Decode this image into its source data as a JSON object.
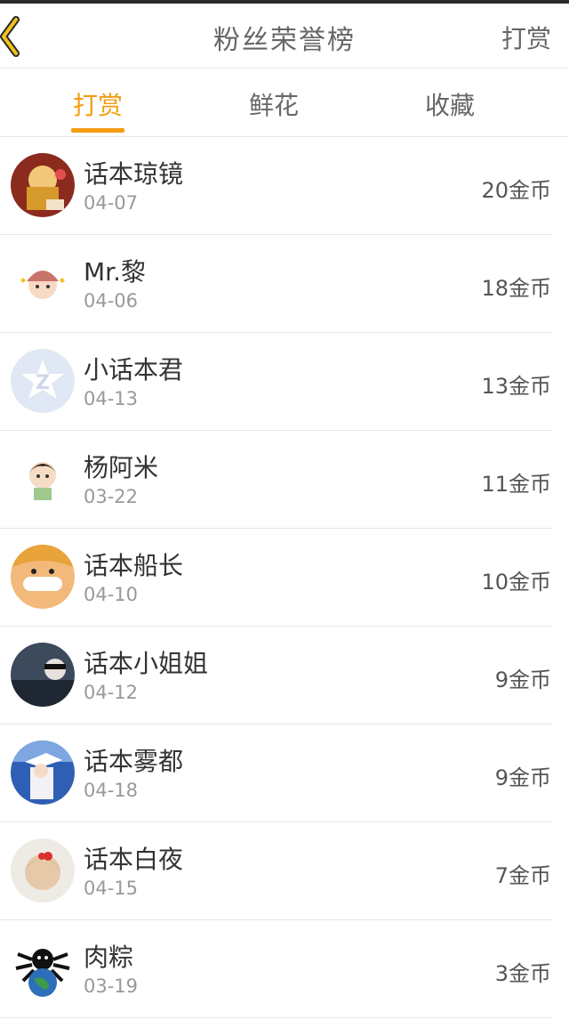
{
  "header": {
    "title": "粉丝荣誉榜",
    "action_label": "打赏",
    "accent": "#f39c12"
  },
  "tabs": [
    {
      "label": "打赏",
      "active": true
    },
    {
      "label": "鲜花",
      "active": false
    },
    {
      "label": "收藏",
      "active": false
    }
  ],
  "fans": [
    {
      "name": "话本琼镜",
      "date": "04-07",
      "amount": "20金币",
      "avatar": "avatar-1"
    },
    {
      "name": "Mr.黎",
      "date": "04-06",
      "amount": "18金币",
      "avatar": "avatar-2"
    },
    {
      "name": "小话本君",
      "date": "04-13",
      "amount": "13金币",
      "avatar": "avatar-3"
    },
    {
      "name": "杨阿米",
      "date": "03-22",
      "amount": "11金币",
      "avatar": "avatar-4"
    },
    {
      "name": "话本船长",
      "date": "04-10",
      "amount": "10金币",
      "avatar": "avatar-5"
    },
    {
      "name": "话本小姐姐",
      "date": "04-12",
      "amount": "9金币",
      "avatar": "avatar-6"
    },
    {
      "name": "话本雾都",
      "date": "04-18",
      "amount": "9金币",
      "avatar": "avatar-7"
    },
    {
      "name": "话本白夜",
      "date": "04-15",
      "amount": "7金币",
      "avatar": "avatar-8"
    },
    {
      "name": "肉粽",
      "date": "03-19",
      "amount": "3金币",
      "avatar": "avatar-9"
    }
  ]
}
